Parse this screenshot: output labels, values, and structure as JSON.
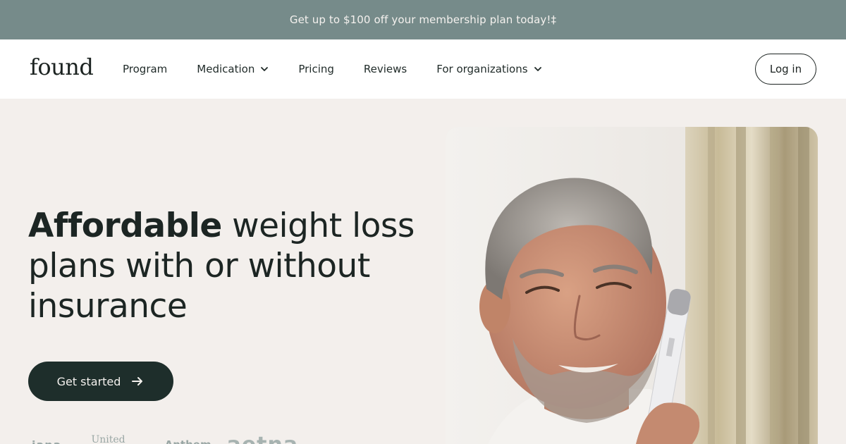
{
  "promo": {
    "text": "Get up to $100 off your membership plan today!‡"
  },
  "header": {
    "logo": "found",
    "nav": [
      {
        "label": "Program",
        "has_dropdown": false
      },
      {
        "label": "Medication",
        "has_dropdown": true
      },
      {
        "label": "Pricing",
        "has_dropdown": false
      },
      {
        "label": "Reviews",
        "has_dropdown": false
      },
      {
        "label": "For organizations",
        "has_dropdown": true
      }
    ],
    "login_label": "Log in"
  },
  "hero": {
    "title_strong": "Affordable",
    "title_rest": " weight loss plans with or without insurance",
    "cta_label": "Get started",
    "cta_icon": "arrow-right-icon",
    "partner_logos": [
      "iana",
      "United",
      "Anthem",
      "aetna"
    ]
  },
  "colors": {
    "promo_bg": "#768b8a",
    "page_bg": "#f3efec",
    "cta_bg": "#1e2e2b",
    "text_dark": "#1c2523"
  }
}
